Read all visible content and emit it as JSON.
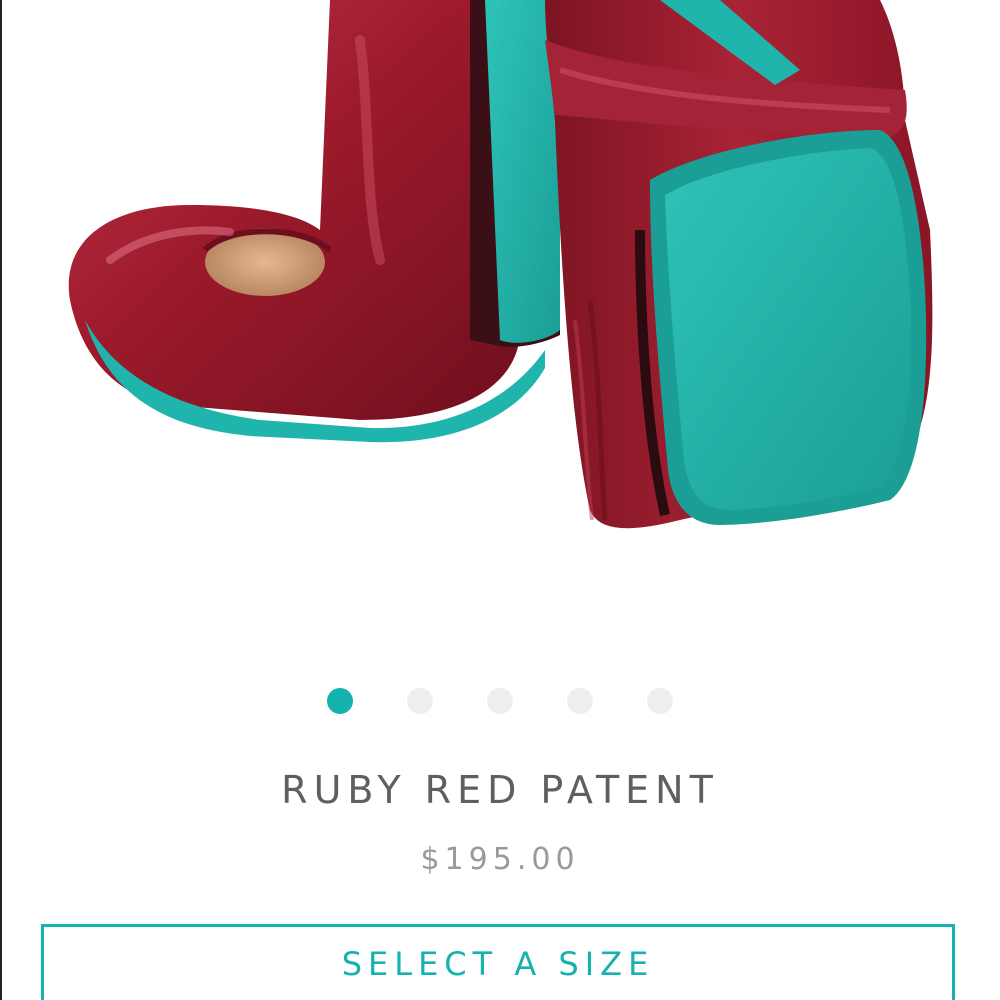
{
  "product": {
    "name": "RUBY RED PATENT",
    "price": "$195.00",
    "image_alt": "Ruby red patent ballet flats with teal soles"
  },
  "carousel": {
    "count": 5,
    "active_index": 0
  },
  "actions": {
    "select_size_label": "SELECT A SIZE"
  },
  "colors": {
    "accent": "#16b3ae",
    "shoe_red": "#9c1a2b",
    "sole_teal": "#23b7ae",
    "title_text": "#5f5f5f",
    "price_text": "#9a9a9a",
    "dot_inactive": "#eeeeee"
  }
}
